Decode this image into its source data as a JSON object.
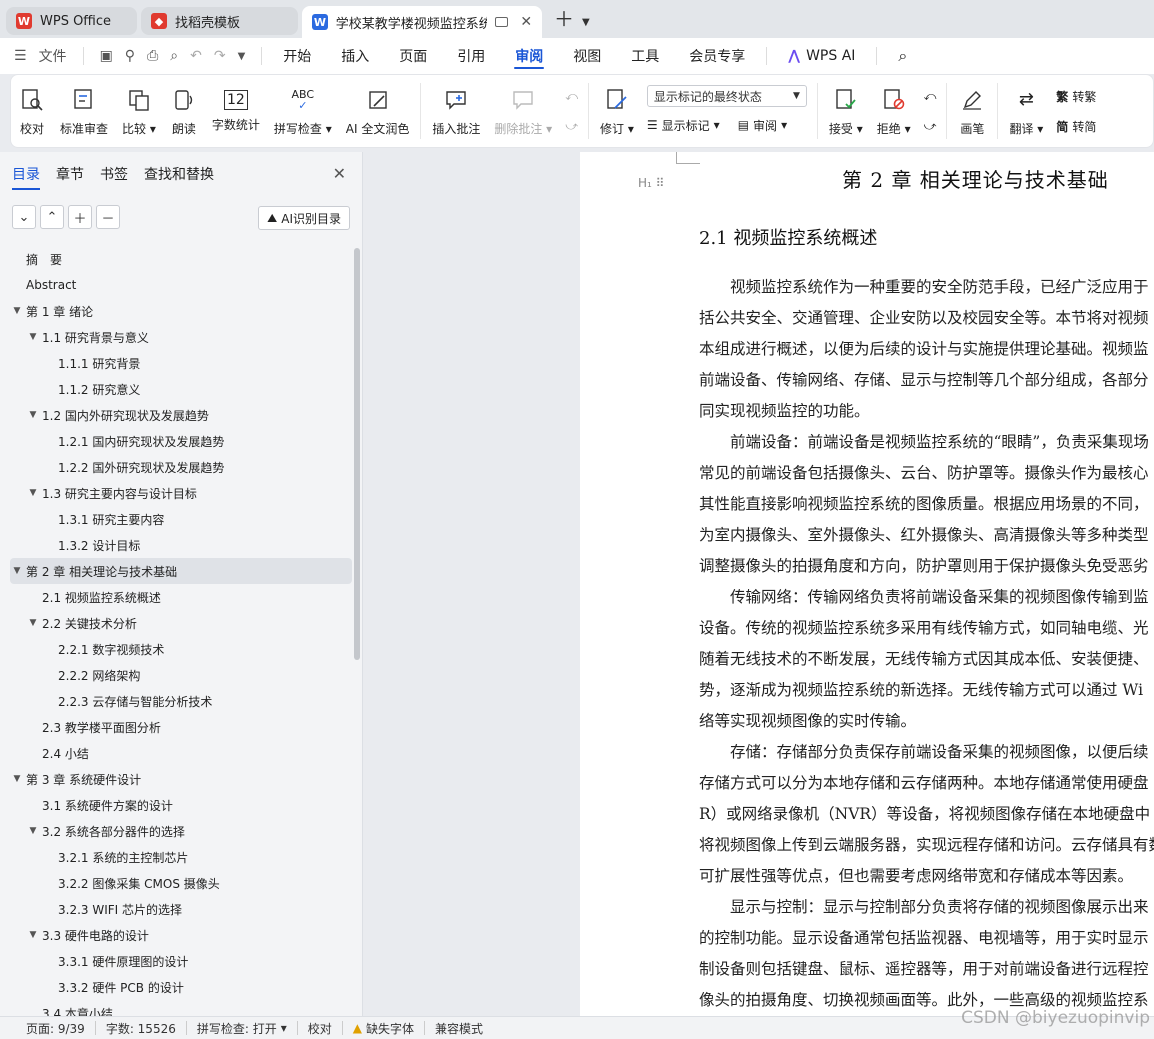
{
  "tabs": [
    {
      "label": "WPS Office",
      "logo": "W",
      "logo_color": "#e03a2f",
      "active": false
    },
    {
      "label": "找稻壳模板",
      "logo": "◆",
      "logo_color": "#e03a2f",
      "active": false
    },
    {
      "label": "学校某教学楼视频监控系统的",
      "logo": "W",
      "logo_color": "#2b6ae0",
      "active": true
    }
  ],
  "menu": {
    "file": "文件",
    "items": [
      "开始",
      "插入",
      "页面",
      "引用",
      "审阅",
      "视图",
      "工具",
      "会员专享",
      "WPS AI"
    ],
    "active": "审阅"
  },
  "ribbon": {
    "proofread": "校对",
    "standard_review": "标准审查",
    "compare": "比较",
    "read_aloud": "朗读",
    "word_count": "字数统计",
    "spell_check": "拼写检查",
    "ai_proofread": "AI 全文润色",
    "insert_comment": "插入批注",
    "delete_comment": "删除批注",
    "track_changes": "修订",
    "markup_select": "显示标记的最终状态",
    "show_markup": "显示标记",
    "review_pane": "审阅",
    "accept": "接受",
    "reject": "拒绝",
    "pen": "画笔",
    "translate": "翻译",
    "to_traditional": "转繁",
    "to_simplified": "转简"
  },
  "sidebar": {
    "tabs": [
      "目录",
      "章节",
      "书签",
      "查找和替换"
    ],
    "active_tab": "目录",
    "ai_button": "AI识别目录",
    "toc": [
      {
        "label": "摘　要",
        "level": 0,
        "arrow": false
      },
      {
        "label": "Abstract",
        "level": 0,
        "arrow": false
      },
      {
        "label": "第 1 章  绪论",
        "level": 0,
        "arrow": true
      },
      {
        "label": "1.1  研究背景与意义",
        "level": 1,
        "arrow": true
      },
      {
        "label": "1.1.1  研究背景",
        "level": 2,
        "arrow": false
      },
      {
        "label": "1.1.2  研究意义",
        "level": 2,
        "arrow": false
      },
      {
        "label": "1.2  国内外研究现状及发展趋势",
        "level": 1,
        "arrow": true
      },
      {
        "label": "1.2.1  国内研究现状及发展趋势",
        "level": 2,
        "arrow": false
      },
      {
        "label": "1.2.2  国外研究现状及发展趋势",
        "level": 2,
        "arrow": false
      },
      {
        "label": "1.3  研究主要内容与设计目标",
        "level": 1,
        "arrow": true
      },
      {
        "label": "1.3.1  研究主要内容",
        "level": 2,
        "arrow": false
      },
      {
        "label": "1.3.2  设计目标",
        "level": 2,
        "arrow": false
      },
      {
        "label": "第 2 章  相关理论与技术基础",
        "level": 0,
        "arrow": true,
        "selected": true
      },
      {
        "label": "2.1  视频监控系统概述",
        "level": 1,
        "arrow": false
      },
      {
        "label": "2.2  关键技术分析",
        "level": 1,
        "arrow": true
      },
      {
        "label": "2.2.1  数字视频技术",
        "level": 2,
        "arrow": false
      },
      {
        "label": "2.2.2  网络架构",
        "level": 2,
        "arrow": false
      },
      {
        "label": "2.2.3  云存储与智能分析技术",
        "level": 2,
        "arrow": false
      },
      {
        "label": "2.3  教学楼平面图分析",
        "level": 1,
        "arrow": false
      },
      {
        "label": "2.4  小结",
        "level": 1,
        "arrow": false
      },
      {
        "label": "第 3 章  系统硬件设计",
        "level": 0,
        "arrow": true
      },
      {
        "label": "3.1 系统硬件方案的设计",
        "level": 1,
        "arrow": false
      },
      {
        "label": "3.2 系统各部分器件的选择",
        "level": 1,
        "arrow": true
      },
      {
        "label": "3.2.1 系统的主控制芯片",
        "level": 2,
        "arrow": false
      },
      {
        "label": "3.2.2 图像采集 CMOS 摄像头",
        "level": 2,
        "arrow": false
      },
      {
        "label": "3.2.3 WIFI 芯片的选择",
        "level": 2,
        "arrow": false
      },
      {
        "label": "3.3 硬件电路的设计",
        "level": 1,
        "arrow": true
      },
      {
        "label": "3.3.1 硬件原理图的设计",
        "level": 2,
        "arrow": false
      },
      {
        "label": "3.3.2 硬件 PCB 的设计",
        "level": 2,
        "arrow": false
      },
      {
        "label": "3.4 本章小结",
        "level": 1,
        "arrow": false
      }
    ]
  },
  "document": {
    "chapter_title": "第 2 章  相关理论与技术基础",
    "section_title": "2.1  视频监控系统概述",
    "lines": [
      {
        "text": "视频监控系统作为一种重要的安全防范手段，已经广泛应用于",
        "indent": true
      },
      {
        "text": "括公共安全、交通管理、企业安防以及校园安全等。本节将对视频",
        "indent": false
      },
      {
        "text": "本组成进行概述，以便为后续的设计与实施提供理论基础。视频监",
        "indent": false
      },
      {
        "text": "前端设备、传输网络、存储、显示与控制等几个部分组成，各部分",
        "indent": false
      },
      {
        "text": "同实现视频监控的功能。",
        "indent": false
      },
      {
        "text": "前端设备：前端设备是视频监控系统的“眼睛”，负责采集现场",
        "indent": true
      },
      {
        "text": "常见的前端设备包括摄像头、云台、防护罩等。摄像头作为最核心",
        "indent": false
      },
      {
        "text": "其性能直接影响视频监控系统的图像质量。根据应用场景的不同，",
        "indent": false
      },
      {
        "text": "为室内摄像头、室外摄像头、红外摄像头、高清摄像头等多种类型",
        "indent": false
      },
      {
        "text": "调整摄像头的拍摄角度和方向，防护罩则用于保护摄像头免受恶劣",
        "indent": false
      },
      {
        "text": "传输网络：传输网络负责将前端设备采集的视频图像传输到监",
        "indent": true
      },
      {
        "text": "设备。传统的视频监控系统多采用有线传输方式，如同轴电缆、光",
        "indent": false
      },
      {
        "text": "随着无线技术的不断发展，无线传输方式因其成本低、安装便捷、",
        "indent": false
      },
      {
        "text": "势，逐渐成为视频监控系统的新选择。无线传输方式可以通过 Wi",
        "indent": false
      },
      {
        "text": "络等实现视频图像的实时传输。",
        "indent": false
      },
      {
        "text": "存储：存储部分负责保存前端设备采集的视频图像，以便后续",
        "indent": true
      },
      {
        "text": "存储方式可以分为本地存储和云存储两种。本地存储通常使用硬盘",
        "indent": false
      },
      {
        "text": "R）或网络录像机（NVR）等设备，将视频图像存储在本地硬盘中",
        "indent": false
      },
      {
        "text": "将视频图像上传到云端服务器，实现远程存储和访问。云存储具有数",
        "indent": false
      },
      {
        "text": "可扩展性强等优点，但也需要考虑网络带宽和存储成本等因素。",
        "indent": false
      },
      {
        "text": "显示与控制：显示与控制部分负责将存储的视频图像展示出来",
        "indent": true
      },
      {
        "text": "的控制功能。显示设备通常包括监视器、电视墙等，用于实时显示",
        "indent": false
      },
      {
        "text": "制设备则包括键盘、鼠标、遥控器等，用于对前端设备进行远程控",
        "indent": false
      },
      {
        "text": "像头的拍摄角度、切换视频画面等。此外，一些高级的视频监控系",
        "indent": false
      }
    ]
  },
  "status": {
    "page": "页面: 9/39",
    "words": "字数: 15526",
    "spell": "拼写检查: 打开",
    "proof": "校对",
    "missing_font": "缺失字体",
    "compat": "兼容模式"
  },
  "watermark": "CSDN @biyezuopinvip",
  "colors": {
    "accent": "#1a56d6"
  }
}
